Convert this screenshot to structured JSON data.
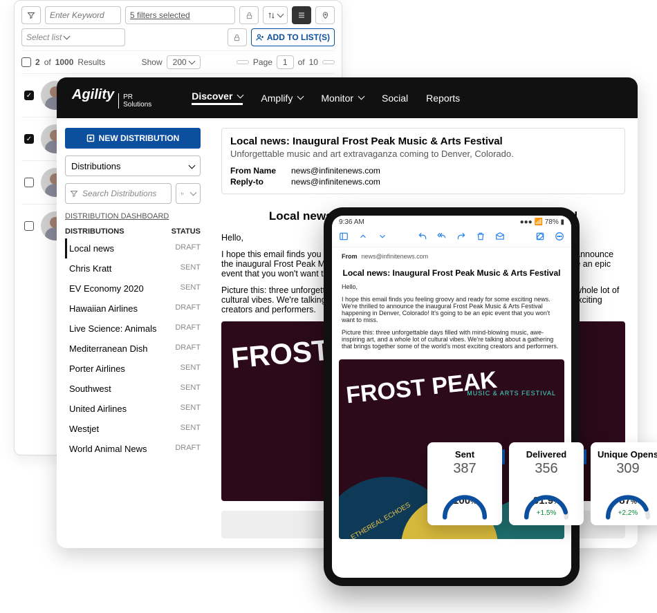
{
  "search": {
    "keyword_placeholder": "Enter Keyword",
    "filters_label": "5 filters selected",
    "select_list_placeholder": "Select list",
    "add_to_list": "ADD TO LIST(S)",
    "results_count": "2",
    "results_total": "1000",
    "results_word": "Results",
    "show_label": "Show",
    "page_size": "200",
    "page_label": "Page",
    "page_current": "1",
    "page_of": "of",
    "page_total": "10",
    "rows": [
      {
        "checked": true
      },
      {
        "checked": true
      },
      {
        "checked": false
      },
      {
        "checked": false
      }
    ]
  },
  "app": {
    "brand_a": "Agility",
    "brand_b_top": "PR",
    "brand_b_bot": "Solutions",
    "nav": [
      "Discover",
      "Amplify",
      "Monitor",
      "Social",
      "Reports"
    ],
    "sidebar": {
      "new_dist": "NEW DISTRIBUTION",
      "select_label": "Distributions",
      "search_placeholder": "Search Distributions",
      "dash_link": "DISTRIBUTION DASHBOARD",
      "col_a": "DISTRIBUTIONS",
      "col_b": "STATUS",
      "items": [
        {
          "name": "Local news",
          "status": "DRAFT",
          "active": true
        },
        {
          "name": "Chris Kratt",
          "status": "SENT"
        },
        {
          "name": "EV Economy 2020",
          "status": "SENT"
        },
        {
          "name": "Hawaiian Airlines",
          "status": "DRAFT"
        },
        {
          "name": "Live Science: Animals",
          "status": "DRAFT"
        },
        {
          "name": "Mediterranean Dish",
          "status": "DRAFT"
        },
        {
          "name": "Porter Airlines",
          "status": "SENT"
        },
        {
          "name": "Southwest",
          "status": "SENT"
        },
        {
          "name": "United Airlines",
          "status": "SENT"
        },
        {
          "name": "Westjet",
          "status": "SENT"
        },
        {
          "name": "World Animal News",
          "status": "DRAFT"
        }
      ]
    },
    "email": {
      "title": "Local news: Inaugural Frost Peak Music & Arts Festival",
      "subtitle": "Unforgettable music and art extravaganza coming to Denver, Colorado.",
      "from_label": "From Name",
      "reply_label": "Reply-to",
      "from": "news@infinitenews.com",
      "reply": "news@infinitenews.com",
      "preview_title": "Local news: Inaugural Frost Peak Music & Arts Festival",
      "p_greet": "Hello,",
      "p1": "I hope this email finds you feeling groovy and ready for some exciting news. We're thrilled to announce the inaugural Frost Peak Music & Arts Festival happening in Denver, Colorado! It's going to be an epic event that you won't want to miss.",
      "p2": "Picture this: three unforgettable days filled with mind-blowing music, awe-inspiring art, and a whole lot of cultural vibes. We're talking about a gathering that brings together some of the world's most exciting creators and performers.",
      "poster_title": "FROST PEAK"
    }
  },
  "tablet": {
    "time": "9:36 AM",
    "battery": "78%",
    "from_label": "From",
    "from": "news@infinitenews.com",
    "title": "Local news: Inaugural Frost Peak Music & Arts Festival",
    "p_greet": "Hello,",
    "p1": "I hope this email finds you feeling groovy and ready for some exciting news. We're thrilled to announce the inaugural Frost Peak Music & Arts Festival happening in Denver, Colorado! It's going to be an epic event that you won't want to miss.",
    "p2": "Picture this: three unforgettable days filled with mind-blowing music, awe-inspiring art, and a whole lot of cultural vibes. We're talking about a gathering that brings together some of the world's most exciting creators and performers.",
    "poster_title": "FROST\nPEAK",
    "poster_sub": "MUSIC & ARTS FESTIVAL",
    "poster_foot": "ETHEREAL ECHOES"
  },
  "metrics": [
    {
      "label": "Sent",
      "value": "387",
      "pct": "100",
      "pct_unit": "%",
      "delta": "",
      "accent": "#0b4f9e",
      "fill": 1.0
    },
    {
      "label": "Delivered",
      "value": "356",
      "pct": "91.9",
      "pct_unit": "%",
      "delta": "+1.5%",
      "accent": "#0b4f9e",
      "fill": 0.919
    },
    {
      "label": "Unique Opens",
      "value": "309",
      "pct": "87",
      "pct_unit": "%",
      "delta": "+2.2%",
      "accent": "#ff3d6e",
      "fill": 0.87
    }
  ]
}
